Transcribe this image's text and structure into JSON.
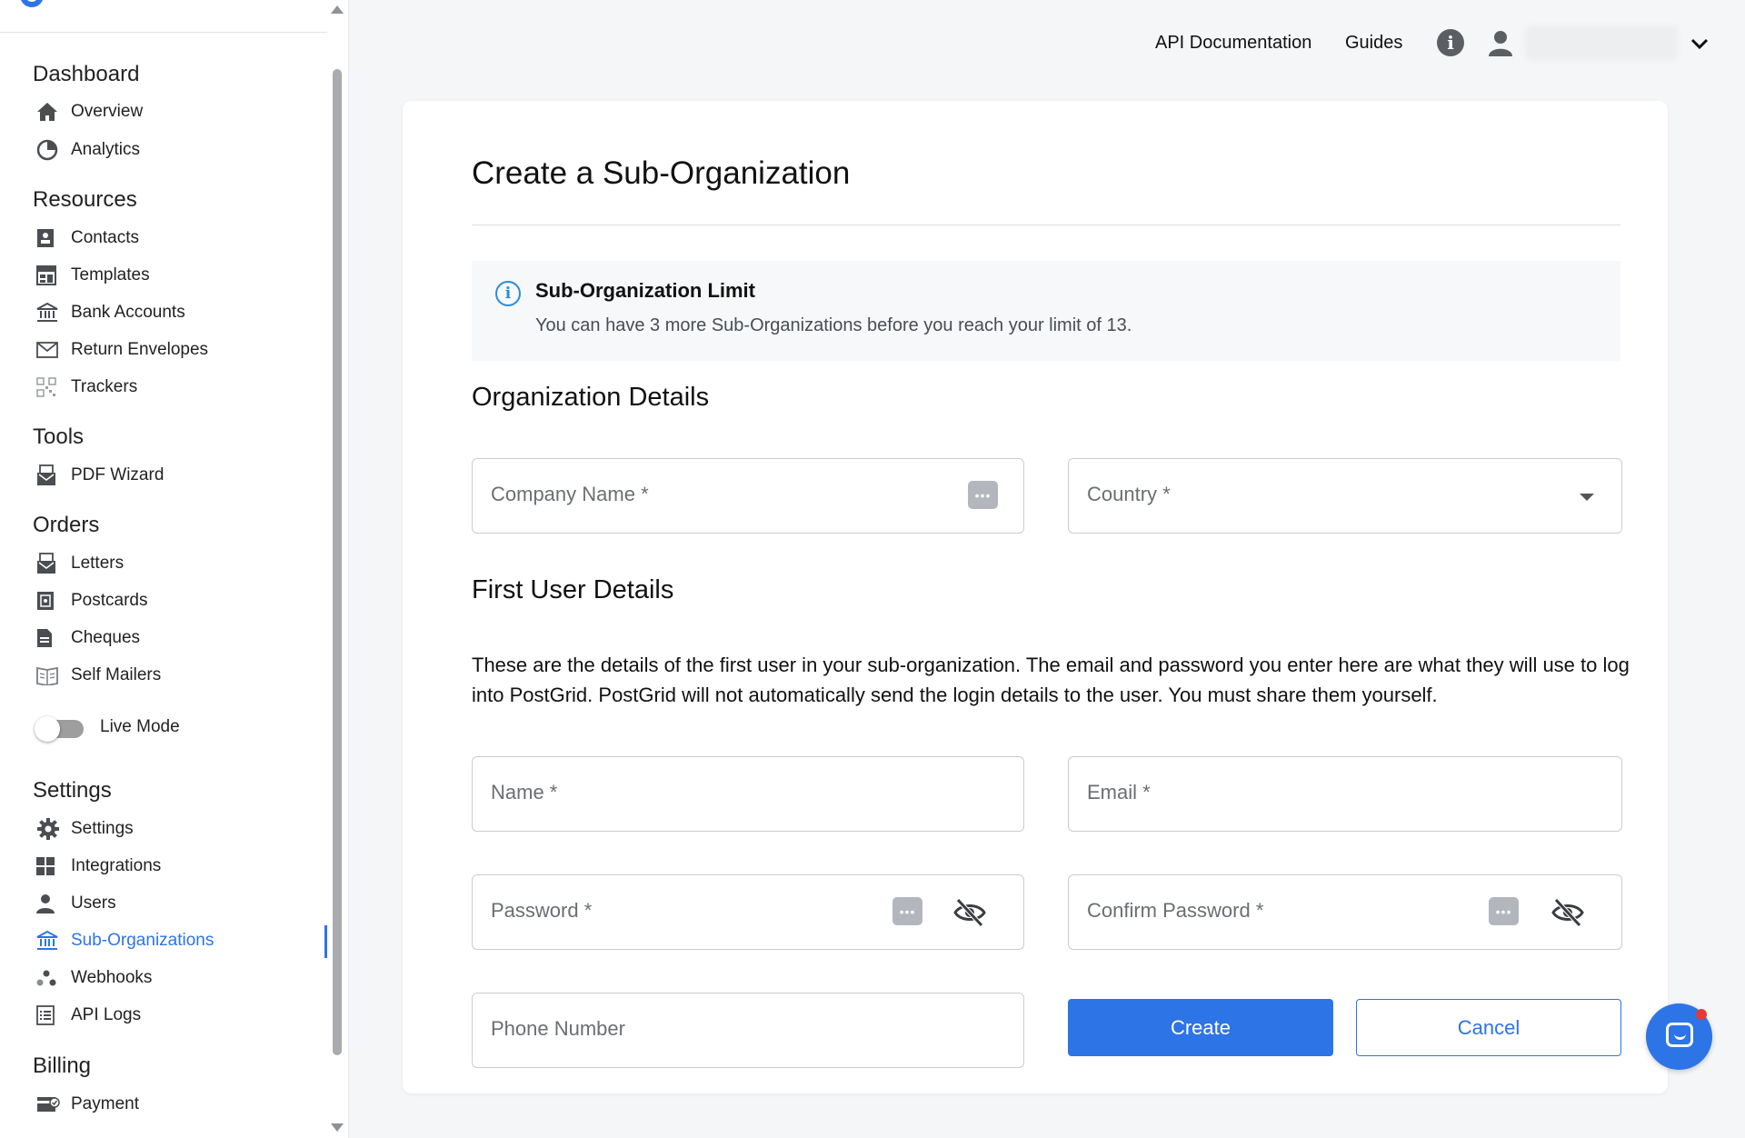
{
  "header": {
    "links": [
      "API Documentation",
      "Guides"
    ],
    "info_icon": "info-icon",
    "user_icon": "person-icon",
    "menu_icon": "chevron-down-icon"
  },
  "sidebar": {
    "sections": [
      {
        "title": "Dashboard",
        "items": [
          {
            "label": "Overview",
            "icon": "home-icon"
          },
          {
            "label": "Analytics",
            "icon": "pie-chart-icon"
          }
        ]
      },
      {
        "title": "Resources",
        "items": [
          {
            "label": "Contacts",
            "icon": "contact-card-icon"
          },
          {
            "label": "Templates",
            "icon": "template-icon"
          },
          {
            "label": "Bank Accounts",
            "icon": "bank-icon"
          },
          {
            "label": "Return Envelopes",
            "icon": "envelope-icon"
          },
          {
            "label": "Trackers",
            "icon": "qr-code-icon"
          }
        ]
      },
      {
        "title": "Tools",
        "items": [
          {
            "label": "PDF Wizard",
            "icon": "pdf-wizard-icon"
          }
        ]
      },
      {
        "title": "Orders",
        "items": [
          {
            "label": "Letters",
            "icon": "letter-icon"
          },
          {
            "label": "Postcards",
            "icon": "postcard-icon"
          },
          {
            "label": "Cheques",
            "icon": "cheque-icon"
          },
          {
            "label": "Self Mailers",
            "icon": "self-mailer-icon"
          }
        ]
      },
      {
        "title": "Settings",
        "items": [
          {
            "label": "Settings",
            "icon": "gear-icon"
          },
          {
            "label": "Integrations",
            "icon": "grid-icon"
          },
          {
            "label": "Users",
            "icon": "user-icon"
          },
          {
            "label": "Sub-Organizations",
            "icon": "bank-icon",
            "active": true
          },
          {
            "label": "Webhooks",
            "icon": "webhook-icon"
          },
          {
            "label": "API Logs",
            "icon": "list-icon"
          }
        ]
      },
      {
        "title": "Billing",
        "items": [
          {
            "label": "Payment",
            "icon": "payment-icon"
          }
        ]
      }
    ],
    "live_mode_label": "Live Mode",
    "live_mode": false
  },
  "page": {
    "title": "Create a Sub-Organization",
    "alert": {
      "title": "Sub-Organization Limit",
      "text": "You can have 3 more Sub-Organizations before you reach your limit of 13."
    },
    "org_section": "Organization Details",
    "user_section": "First User Details",
    "user_description": "These are the details of the first user in your sub-organization. The email and password you enter here are what they will use to log into PostGrid. PostGrid will not automatically send the login details to the user. You must share them yourself.",
    "fields": {
      "company_name": "Company Name *",
      "country": "Country *",
      "name": "Name *",
      "email": "Email *",
      "password": "Password *",
      "confirm_password": "Confirm Password *",
      "phone": "Phone Number"
    },
    "buttons": {
      "create": "Create",
      "cancel": "Cancel"
    }
  },
  "colors": {
    "accent": "#2d74e6",
    "info": "#2d8bd8"
  }
}
